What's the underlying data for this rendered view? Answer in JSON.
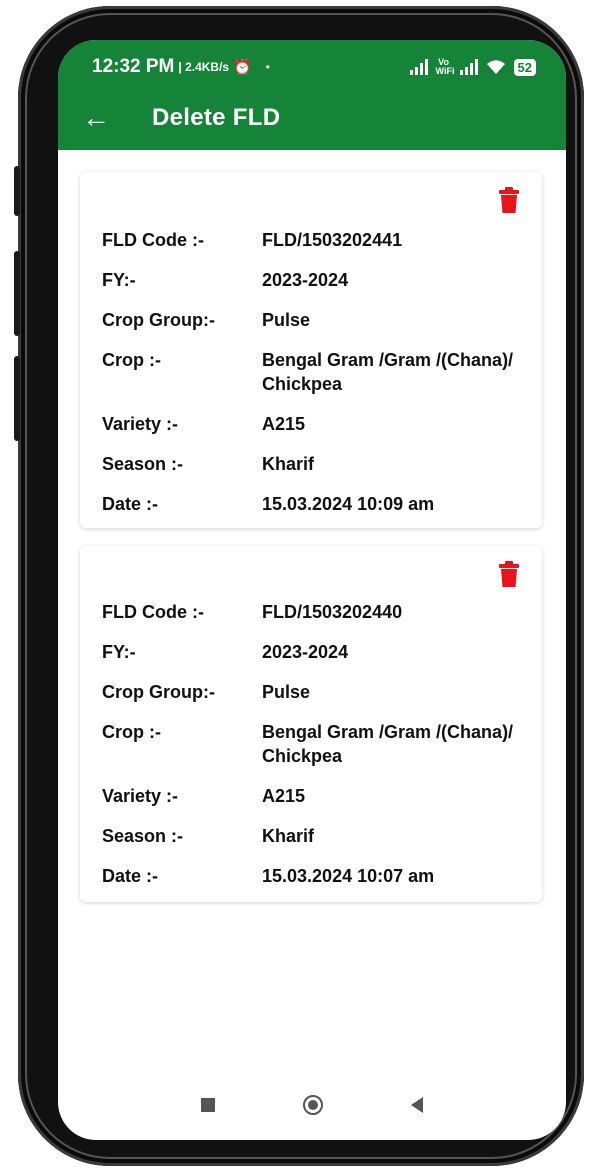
{
  "status": {
    "time": "12:32 PM",
    "speed": "| 2.4KB/s",
    "wifi_label": "Vo WiFi",
    "battery": "52"
  },
  "header": {
    "title": "Delete FLD"
  },
  "labels": {
    "fld_code": "FLD Code :-",
    "fy": "FY:-",
    "crop_group": "Crop Group:-",
    "crop": "Crop :-",
    "variety": "Variety :-",
    "season": "Season :-",
    "date": "Date :-"
  },
  "records": [
    {
      "fld_code": "FLD/1503202441",
      "fy": "2023-2024",
      "crop_group": "Pulse",
      "crop": "Bengal Gram /Gram /(Chana)/",
      "crop_line2": "Chickpea",
      "variety": "A215",
      "season": "Kharif",
      "date": "15.03.2024 10:09 am"
    },
    {
      "fld_code": "FLD/1503202440",
      "fy": "2023-2024",
      "crop_group": "Pulse",
      "crop": "Bengal Gram /Gram /(Chana)/",
      "crop_line2": "Chickpea",
      "variety": "A215",
      "season": "Kharif",
      "date": "15.03.2024 10:07 am"
    }
  ],
  "colors": {
    "appbar": "#168438",
    "delete": "#e8141a"
  },
  "icons": {
    "back": "arrow-left-icon",
    "delete": "trash-icon"
  }
}
